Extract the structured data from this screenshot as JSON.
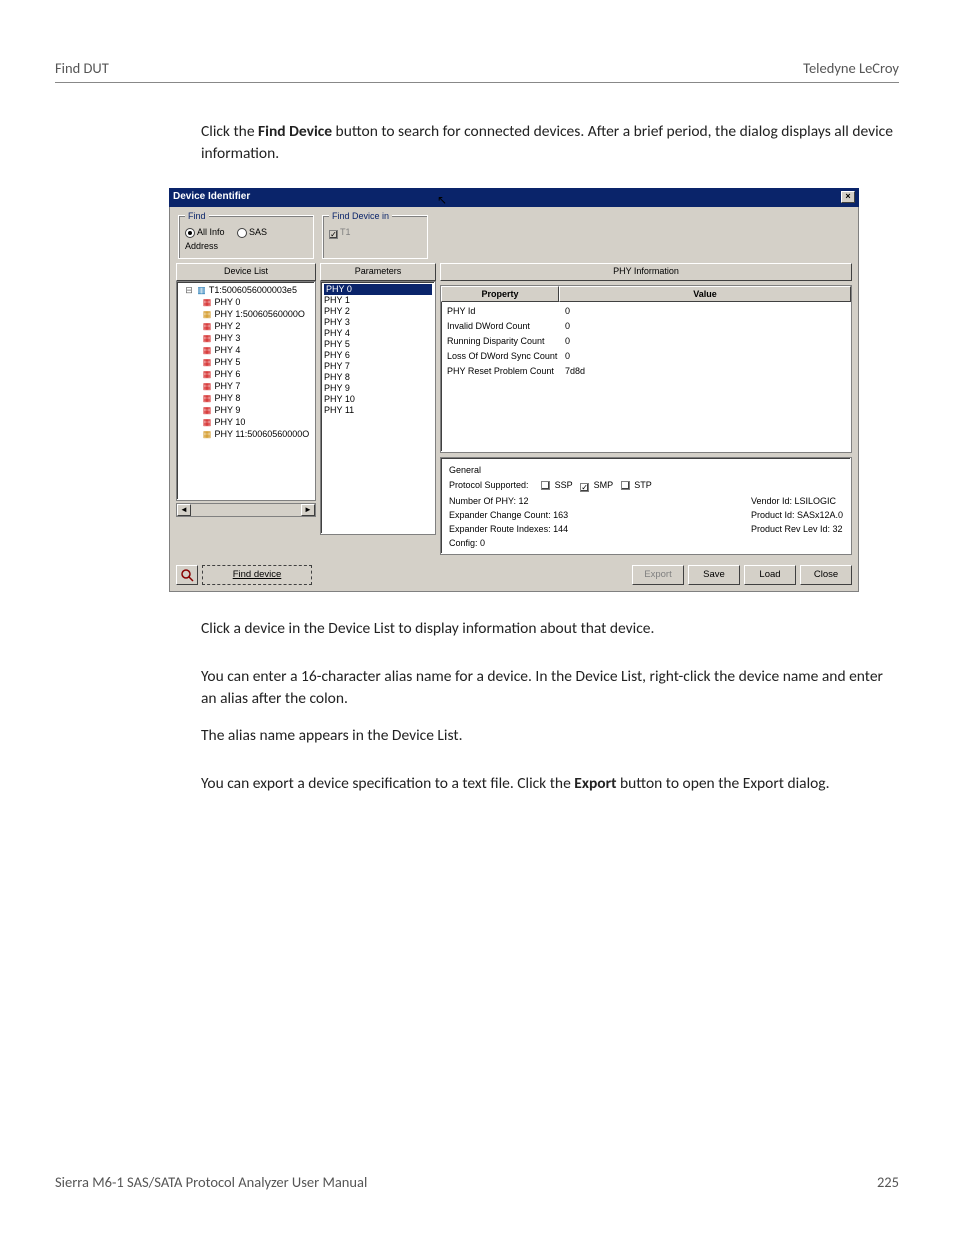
{
  "header": {
    "left": "Find DUT",
    "right": "Teledyne LeCroy"
  },
  "para1": {
    "pre": "Click the ",
    "bold": "Find Device",
    "post": " button to search for connected devices. After a brief period, the dialog displays all device information."
  },
  "para2": "Click a device in the Device List to display information about that device.",
  "para3": "You can enter a 16-character alias name for a device. In the Device List, right-click the device name and enter an alias after the colon.",
  "para4": "The alias name appears in the Device List.",
  "para5": {
    "pre": "You can export a device specification to a text file. Click the ",
    "bold": "Export",
    "post": " button to open the Export dialog."
  },
  "footer": {
    "left": "Sierra M6-1 SAS/SATA Protocol Analyzer User Manual",
    "right": "225"
  },
  "dlg": {
    "title": "Device Identifier",
    "find": {
      "legend": "Find",
      "opt1": "All Info",
      "opt2": "SAS Address"
    },
    "find_in": {
      "legend": "Find Device in",
      "t1": "T1"
    },
    "cols": {
      "device_list": "Device List",
      "parameters": "Parameters",
      "phy_info": "PHY Information"
    },
    "tree": {
      "root": "T1:5006056000003e5",
      "items": [
        "PHY 0",
        "PHY 1:50060560000O",
        "PHY 2",
        "PHY 3",
        "PHY 4",
        "PHY 5",
        "PHY 6",
        "PHY 7",
        "PHY 8",
        "PHY 9",
        "PHY 10",
        "PHY 11:50060560000O"
      ]
    },
    "params": [
      "PHY 0",
      "PHY 1",
      "PHY 2",
      "PHY 3",
      "PHY 4",
      "PHY 5",
      "PHY 6",
      "PHY 7",
      "PHY 8",
      "PHY 9",
      "PHY 10",
      "PHY 11"
    ],
    "phy_headers": {
      "prop": "Property",
      "val": "Value"
    },
    "phy_rows": [
      {
        "p": "PHY Id",
        "v": "0"
      },
      {
        "p": "Invalid DWord Count",
        "v": "0"
      },
      {
        "p": "Running Disparity Count",
        "v": "0"
      },
      {
        "p": "Loss Of DWord Sync Count",
        "v": "0"
      },
      {
        "p": "PHY Reset Problem Count",
        "v": "7d8d"
      }
    ],
    "general": {
      "legend": "General",
      "protocol_label": "Protocol Supported:",
      "ssp": "SSP",
      "smp": "SMP",
      "stp": "STP",
      "left": [
        "Number Of PHY: 12",
        "Expander Change Count: 163",
        "Expander Route Indexes: 144",
        "Config: 0"
      ],
      "right": [
        "Vendor Id: LSILOGIC",
        "Product Id: SASx12A.0",
        "Product Rev Lev Id: 32"
      ]
    },
    "buttons": {
      "find": "Find device",
      "export": "Export",
      "save": "Save",
      "load": "Load",
      "close": "Close"
    }
  }
}
